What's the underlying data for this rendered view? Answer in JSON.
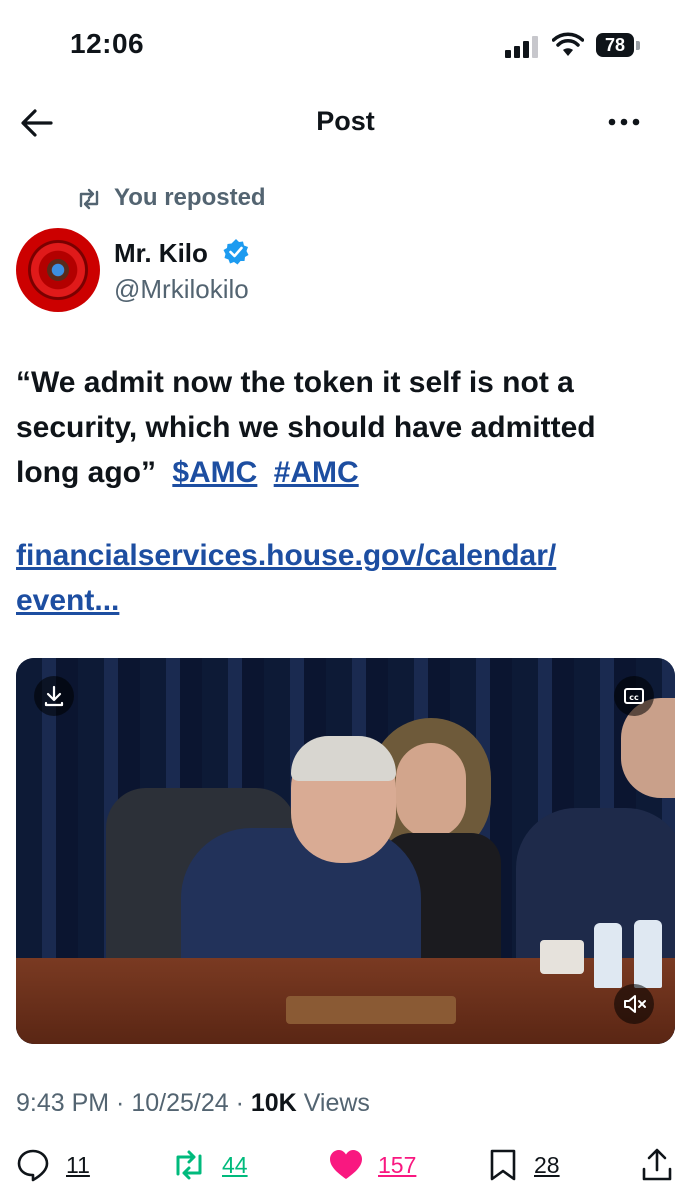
{
  "status_bar": {
    "time": "12:06",
    "battery": "78"
  },
  "header": {
    "title": "Post"
  },
  "repost_label": "You reposted",
  "author": {
    "name": "Mr. Kilo",
    "handle": "@Mrkilokilo"
  },
  "tweet": {
    "text": "“We admit now the token it self is not a security, which we should have admitted long ago”",
    "cashtag": "$AMC",
    "hashtag": "#AMC",
    "url_line1": "financialservices.house.gov/calendar/",
    "url_line2": "event..."
  },
  "meta": {
    "time": "9:43 PM",
    "sep1": " · ",
    "date": "10/25/24",
    "sep2": " · ",
    "views_count": "10K",
    "views_label": " Views"
  },
  "actions": {
    "replies": "11",
    "reposts": "44",
    "likes": "157",
    "bookmarks": "28"
  },
  "colors": {
    "link": "#1d4ea1",
    "repost_green": "#00ba7c",
    "like_pink": "#f91880",
    "muted": "#536471"
  }
}
